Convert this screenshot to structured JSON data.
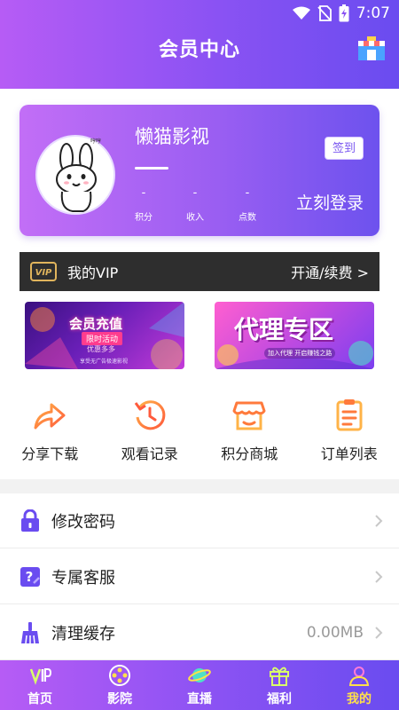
{
  "status_bar": {
    "time": "7:07"
  },
  "header": {
    "title": "会员中心"
  },
  "card": {
    "username": "懒猫影视",
    "avatar_caption": "哼哼",
    "checkin_label": "签到",
    "login_label": "立刻登录",
    "stats": [
      {
        "value": "-",
        "label": "积分"
      },
      {
        "value": "-",
        "label": "收入"
      },
      {
        "value": "-",
        "label": "点数"
      }
    ]
  },
  "vip": {
    "badge": "VIP",
    "label": "我的VIP",
    "action": "开通/续费 >"
  },
  "banners": {
    "left": {
      "title": "会员充值",
      "line1": "限时活动",
      "line2": "优惠多多",
      "line3": "享受无广告极速影视"
    },
    "right": {
      "title": "代理专区",
      "line1": "加入代理 开启赚钱之路"
    }
  },
  "shortcuts": [
    {
      "label": "分享下载",
      "icon": "share-arrow-icon"
    },
    {
      "label": "观看记录",
      "icon": "history-clock-icon"
    },
    {
      "label": "积分商城",
      "icon": "store-icon"
    },
    {
      "label": "订单列表",
      "icon": "order-list-icon"
    }
  ],
  "menu": [
    {
      "label": "修改密码",
      "icon": "lock-icon",
      "value": ""
    },
    {
      "label": "专属客服",
      "icon": "help-icon",
      "value": ""
    },
    {
      "label": "清理缓存",
      "icon": "broom-icon",
      "value": "0.00MB"
    }
  ],
  "tabs": [
    {
      "label": "首页",
      "icon": "vip-home-icon",
      "active": false
    },
    {
      "label": "影院",
      "icon": "film-reel-icon",
      "active": false
    },
    {
      "label": "直播",
      "icon": "planet-icon",
      "active": false
    },
    {
      "label": "福利",
      "icon": "gift-icon",
      "active": false
    },
    {
      "label": "我的",
      "icon": "profile-icon",
      "active": true
    }
  ],
  "colors": {
    "accent_start": "#b65cf5",
    "accent_end": "#6a4cf0",
    "active_tab": "#ffe14a",
    "vip_bar": "#2e2e2e"
  }
}
